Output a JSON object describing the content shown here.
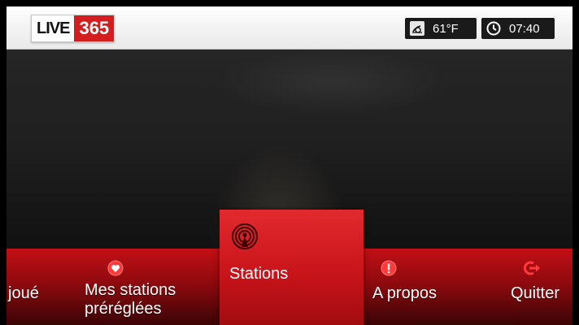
{
  "header": {
    "logo": {
      "left_text": "LIVE",
      "right_text": "365"
    },
    "weather": {
      "icon": "weather-icon",
      "temperature": "61°F"
    },
    "clock": {
      "icon": "clock-icon",
      "time": "07:40"
    }
  },
  "menu": {
    "items": [
      {
        "id": "recently-played",
        "label": "joué"
      },
      {
        "id": "presets",
        "label": "Mes stations\npréréglées",
        "icon": "heart-icon"
      },
      {
        "id": "stations",
        "label": "Stations",
        "icon": "broadcast-icon",
        "selected": true
      },
      {
        "id": "about",
        "label": "A propos",
        "icon": "info-icon"
      },
      {
        "id": "quit",
        "label": "Quitter",
        "icon": "exit-icon"
      }
    ]
  },
  "colors": {
    "brand_red": "#d21e1e",
    "menu_red": "#c20f15",
    "selected_red": "#e22a2e"
  }
}
